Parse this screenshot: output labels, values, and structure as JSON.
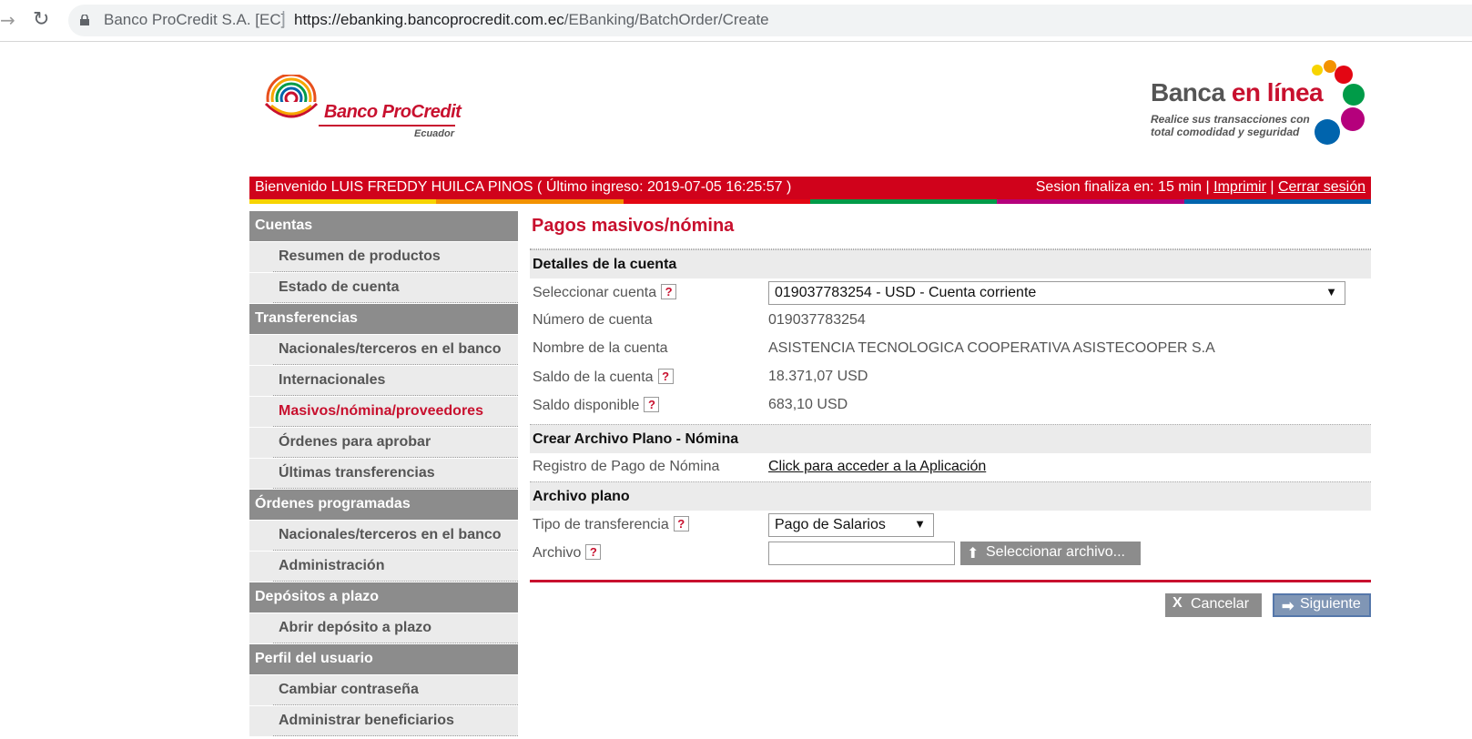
{
  "browser": {
    "site_name": "Banco ProCredit S.A. [EC]",
    "url_host": "https://ebanking.bancoprocredit.com.ec",
    "url_path": "/EBanking/BatchOrder/Create"
  },
  "header": {
    "logo_text": "Banco ProCredit",
    "logo_sub": "Ecuador",
    "banca_a": "Banca",
    "banca_b": "en línea",
    "banca_sub_1": "Realice sus transacciones con",
    "banca_sub_2": "total comodidad y seguridad"
  },
  "topbar": {
    "welcome": "Bienvenido LUIS FREDDY HUILCA PINOS ( Último ingreso: 2019-07-05 16:25:57 )",
    "session": "Sesion finaliza en: 15 min |",
    "print": "Imprimir",
    "sep": "|",
    "logout": "Cerrar sesión"
  },
  "sidebar": {
    "cuentas": "Cuentas",
    "resumen": "Resumen de productos",
    "estado": "Estado de cuenta",
    "transferencias": "Transferencias",
    "nacionales": "Nacionales/terceros en el banco",
    "internacionales": "Internacionales",
    "masivos": "Masivos/nómina/proveedores",
    "ordenes_aprobar": "Órdenes para aprobar",
    "ultimas": "Últimas transferencias",
    "programadas": "Órdenes programadas",
    "prog_nacionales": "Nacionales/terceros en el banco",
    "administracion": "Administración",
    "depositos": "Depósitos a plazo",
    "abrir_deposito": "Abrir depósito a plazo",
    "perfil": "Perfil del usuario",
    "cambiar": "Cambiar contraseña",
    "beneficiarios": "Administrar beneficiarios"
  },
  "main": {
    "title": "Pagos masivos/nómina",
    "detalles": "Detalles de la cuenta",
    "sel_cuenta_label": "Seleccionar cuenta",
    "sel_cuenta_value": "019037783254 - USD - Cuenta corriente",
    "num_cuenta_label": "Número de cuenta",
    "num_cuenta_value": "019037783254",
    "nombre_label": "Nombre de la cuenta",
    "nombre_value": "ASISTENCIA TECNOLOGICA COOPERATIVA ASISTECOOPER S.A",
    "saldo_label": "Saldo de la cuenta",
    "saldo_value": "18.371,07 USD",
    "disp_label": "Saldo disponible",
    "disp_value": "683,10 USD",
    "crear": "Crear Archivo Plano - Nómina",
    "registro_label": "Registro de Pago de Nómina",
    "registro_link": "Click para acceder a la Aplicación",
    "archivo_plano": "Archivo plano",
    "tipo_label": "Tipo de transferencia",
    "tipo_value": "Pago de Salarios",
    "archivo_label": "Archivo",
    "select_file": "Seleccionar archivo...",
    "cancel": "Cancelar",
    "next": "Siguiente",
    "help": "?"
  }
}
